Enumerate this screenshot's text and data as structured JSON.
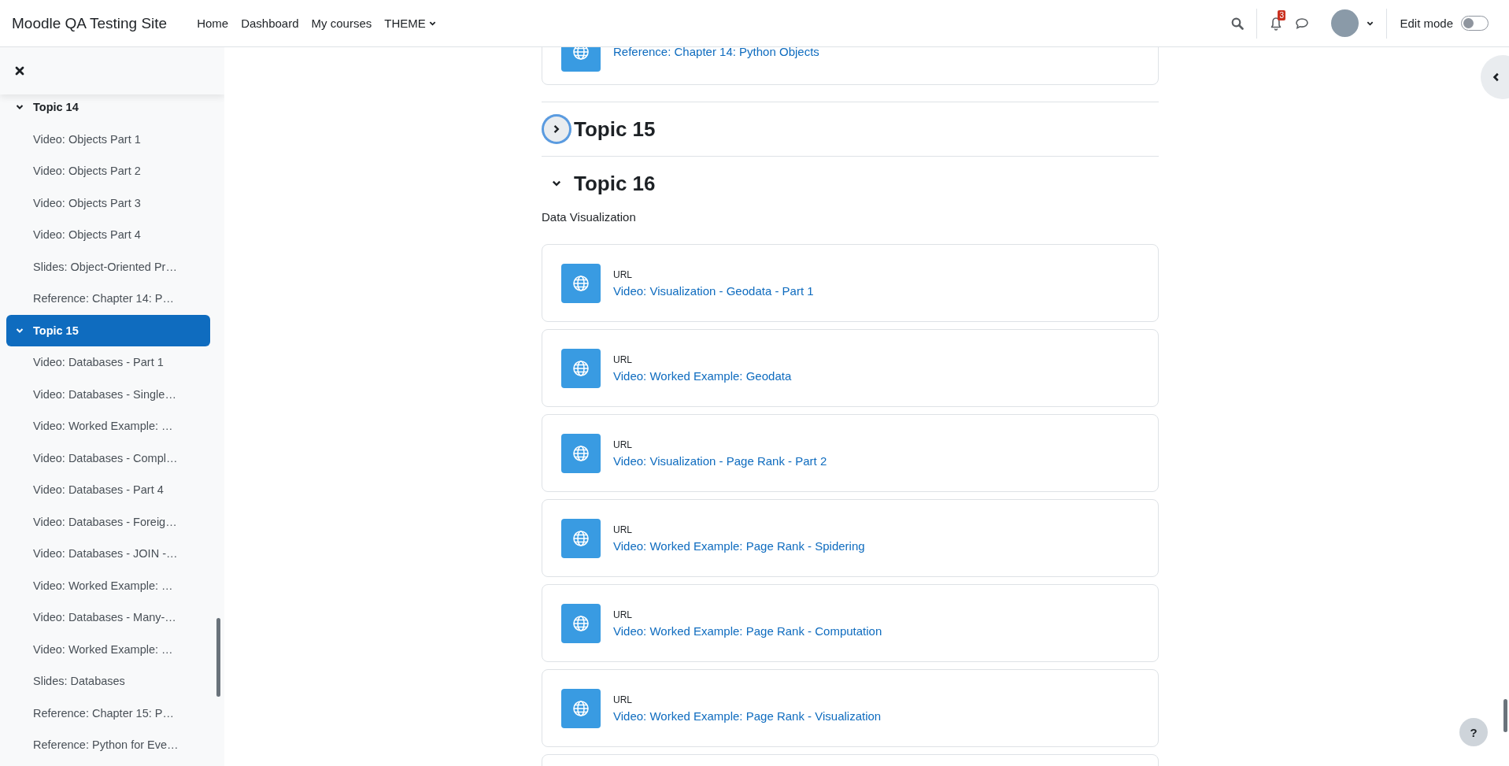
{
  "header": {
    "site_name": "Moodle QA Testing Site",
    "nav": [
      {
        "label": "Home",
        "dropdown": false
      },
      {
        "label": "Dashboard",
        "dropdown": false
      },
      {
        "label": "My courses",
        "dropdown": false
      },
      {
        "label": "THEME",
        "dropdown": true
      }
    ],
    "notification_count": "3",
    "edit_mode": {
      "label": "Edit mode",
      "on": false
    }
  },
  "sidebar": {
    "sections": [
      {
        "title": "Topic 14",
        "expanded": true,
        "selected": false,
        "items": [
          "Video: Objects Part 1",
          "Video: Objects Part 2",
          "Video: Objects Part 3",
          "Video: Objects Part 4",
          "Slides: Object-Oriented Pr…",
          "Reference: Chapter 14: P…"
        ]
      },
      {
        "title": "Topic 15",
        "expanded": true,
        "selected": true,
        "items": [
          "Video: Databases - Part 1",
          "Video: Databases - Single…",
          "Video: Worked Example: …",
          "Video: Databases - Compl…",
          "Video: Databases - Part 4",
          "Video: Databases - Foreig…",
          "Video: Databases - JOIN -…",
          "Video: Worked Example: …",
          "Video: Databases - Many-…",
          "Video: Worked Example: …",
          "Slides: Databases",
          "Reference: Chapter 15: P…",
          "Reference: Python for Eve…"
        ]
      }
    ]
  },
  "content": {
    "top_card": {
      "link": "Reference: Chapter 14: Python Objects"
    },
    "sections": [
      {
        "title": "Topic 15",
        "expanded": false,
        "focused": true
      },
      {
        "title": "Topic 16",
        "expanded": true,
        "focused": false,
        "description": "Data Visualization",
        "activities": [
          {
            "type": "URL",
            "name": "Video: Visualization - Geodata - Part 1"
          },
          {
            "type": "URL",
            "name": "Video: Worked Example: Geodata"
          },
          {
            "type": "URL",
            "name": "Video: Visualization - Page Rank - Part 2"
          },
          {
            "type": "URL",
            "name": "Video: Worked Example: Page Rank - Spidering"
          },
          {
            "type": "URL",
            "name": "Video: Worked Example: Page Rank - Computation"
          },
          {
            "type": "URL",
            "name": "Video: Worked Example: Page Rank - Visualization"
          }
        ]
      }
    ]
  },
  "help_button": "?"
}
